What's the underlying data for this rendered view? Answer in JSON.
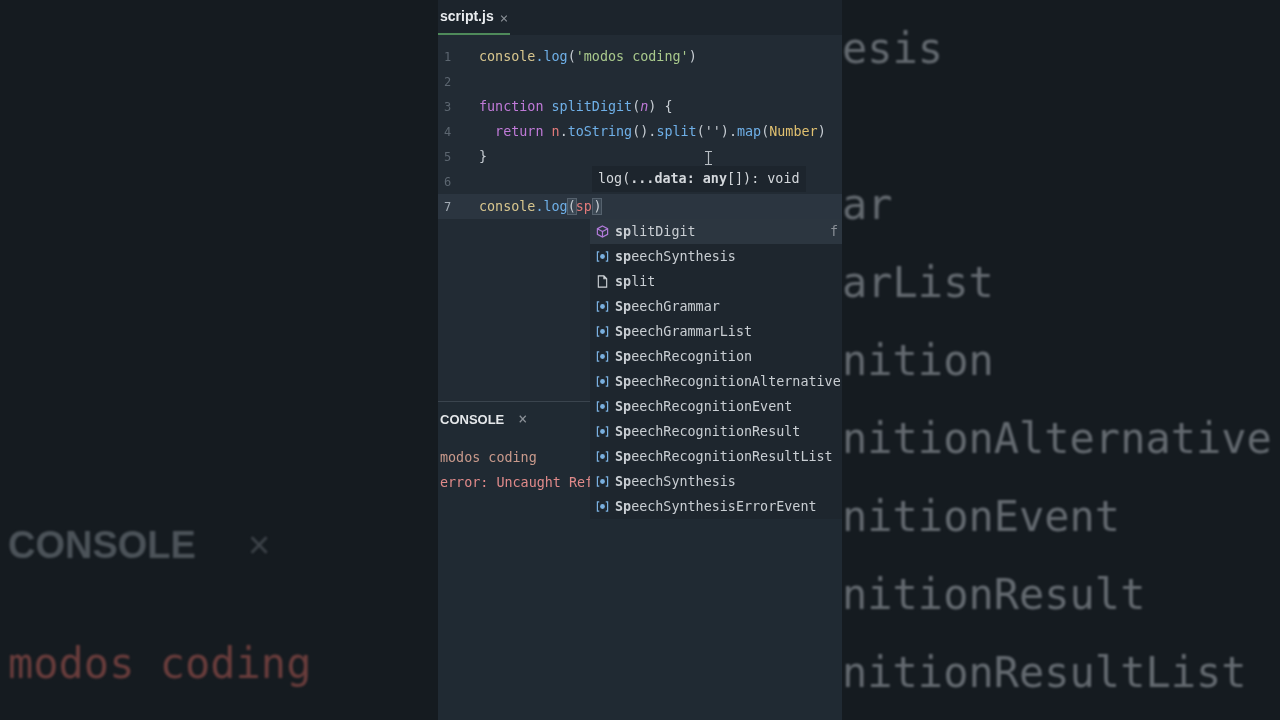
{
  "backdrop": {
    "left": [
      {
        "kind": "heading",
        "text": "CONSOLE",
        "close": "×"
      },
      {
        "kind": "log",
        "text": "modos coding"
      }
    ],
    "right": [
      "esis",
      "ar",
      "arList",
      "nition",
      "nitionAlternative",
      "nitionEvent",
      "nitionResult",
      "nitionResultList"
    ]
  },
  "tabs": [
    {
      "label": "script.js",
      "close": "×",
      "selected": true
    }
  ],
  "editor": {
    "lines": [
      {
        "number": "1",
        "current": false,
        "tokens": [
          {
            "t": "console",
            "kind": "obj"
          },
          {
            "t": ".log",
            "kind": "fn"
          },
          {
            "t": "(",
            "kind": "punct"
          },
          {
            "t": "'modos coding'",
            "kind": "str"
          },
          {
            "t": ")",
            "kind": "punct"
          }
        ]
      },
      {
        "number": "2",
        "current": false
      },
      {
        "number": "3",
        "current": false,
        "tokens": [
          {
            "t": "function ",
            "kind": "kw"
          },
          {
            "t": "splitDigit",
            "kind": "fn"
          },
          {
            "t": "(",
            "kind": "punct"
          },
          {
            "t": "n",
            "kind": "param"
          },
          {
            "t": ") {",
            "kind": "punct"
          }
        ]
      },
      {
        "number": "4",
        "current": false,
        "tokens": [
          {
            "t": "  return ",
            "kind": "kw"
          },
          {
            "t": "n",
            "kind": "var"
          },
          {
            "t": ".",
            "kind": "punct"
          },
          {
            "t": "toString",
            "kind": "fn"
          },
          {
            "t": "().",
            "kind": "punct"
          },
          {
            "t": "split",
            "kind": "fn"
          },
          {
            "t": "('').",
            "kind": "punct"
          },
          {
            "t": "map",
            "kind": "fn"
          },
          {
            "t": "(",
            "kind": "punct"
          },
          {
            "t": "Number",
            "kind": "type"
          },
          {
            "t": ")",
            "kind": "punct"
          }
        ]
      },
      {
        "number": "5",
        "current": false,
        "tokens": [
          {
            "t": "}",
            "kind": "punct"
          }
        ]
      },
      {
        "number": "6",
        "current": false
      },
      {
        "number": "7",
        "current": true,
        "tokens": [
          {
            "t": "console",
            "kind": "obj"
          },
          {
            "t": ".log",
            "kind": "fn"
          },
          {
            "t": "(",
            "kind": "bracket"
          },
          {
            "t": "sp",
            "kind": "var",
            "caret": true
          },
          {
            "t": ")",
            "kind": "bracket"
          }
        ]
      }
    ],
    "tooltip": "log(**...data: any**[]): void",
    "suggestions": [
      {
        "kind": "function",
        "label": "**sp**litDigit",
        "detail": "f",
        "selected": true
      },
      {
        "kind": "variable",
        "label": "**sp**eechSynthesis",
        "selected": false
      },
      {
        "kind": "text",
        "label": "**sp**lit",
        "selected": false
      },
      {
        "kind": "variable",
        "label": "**Sp**eechGrammar",
        "selected": false
      },
      {
        "kind": "variable",
        "label": "**Sp**eechGrammarList",
        "selected": false
      },
      {
        "kind": "variable",
        "label": "**Sp**eechRecognition",
        "selected": false
      },
      {
        "kind": "variable",
        "label": "**Sp**eechRecognitionAlternative",
        "selected": false
      },
      {
        "kind": "variable",
        "label": "**Sp**eechRecognitionEvent",
        "selected": false
      },
      {
        "kind": "variable",
        "label": "**Sp**eechRecognitionResult",
        "selected": false
      },
      {
        "kind": "variable",
        "label": "**Sp**eechRecognitionResultList",
        "selected": false
      },
      {
        "kind": "variable",
        "label": "**Sp**eechSynthesis",
        "selected": false
      },
      {
        "kind": "variable",
        "label": "**Sp**eechSynthesisErrorEvent",
        "selected": false
      }
    ]
  },
  "console": {
    "title": "CONSOLE",
    "close": "×",
    "output": [
      {
        "kind": "log",
        "text": "modos coding"
      },
      {
        "kind": "error",
        "text": "error: Uncaught Ref"
      }
    ]
  }
}
